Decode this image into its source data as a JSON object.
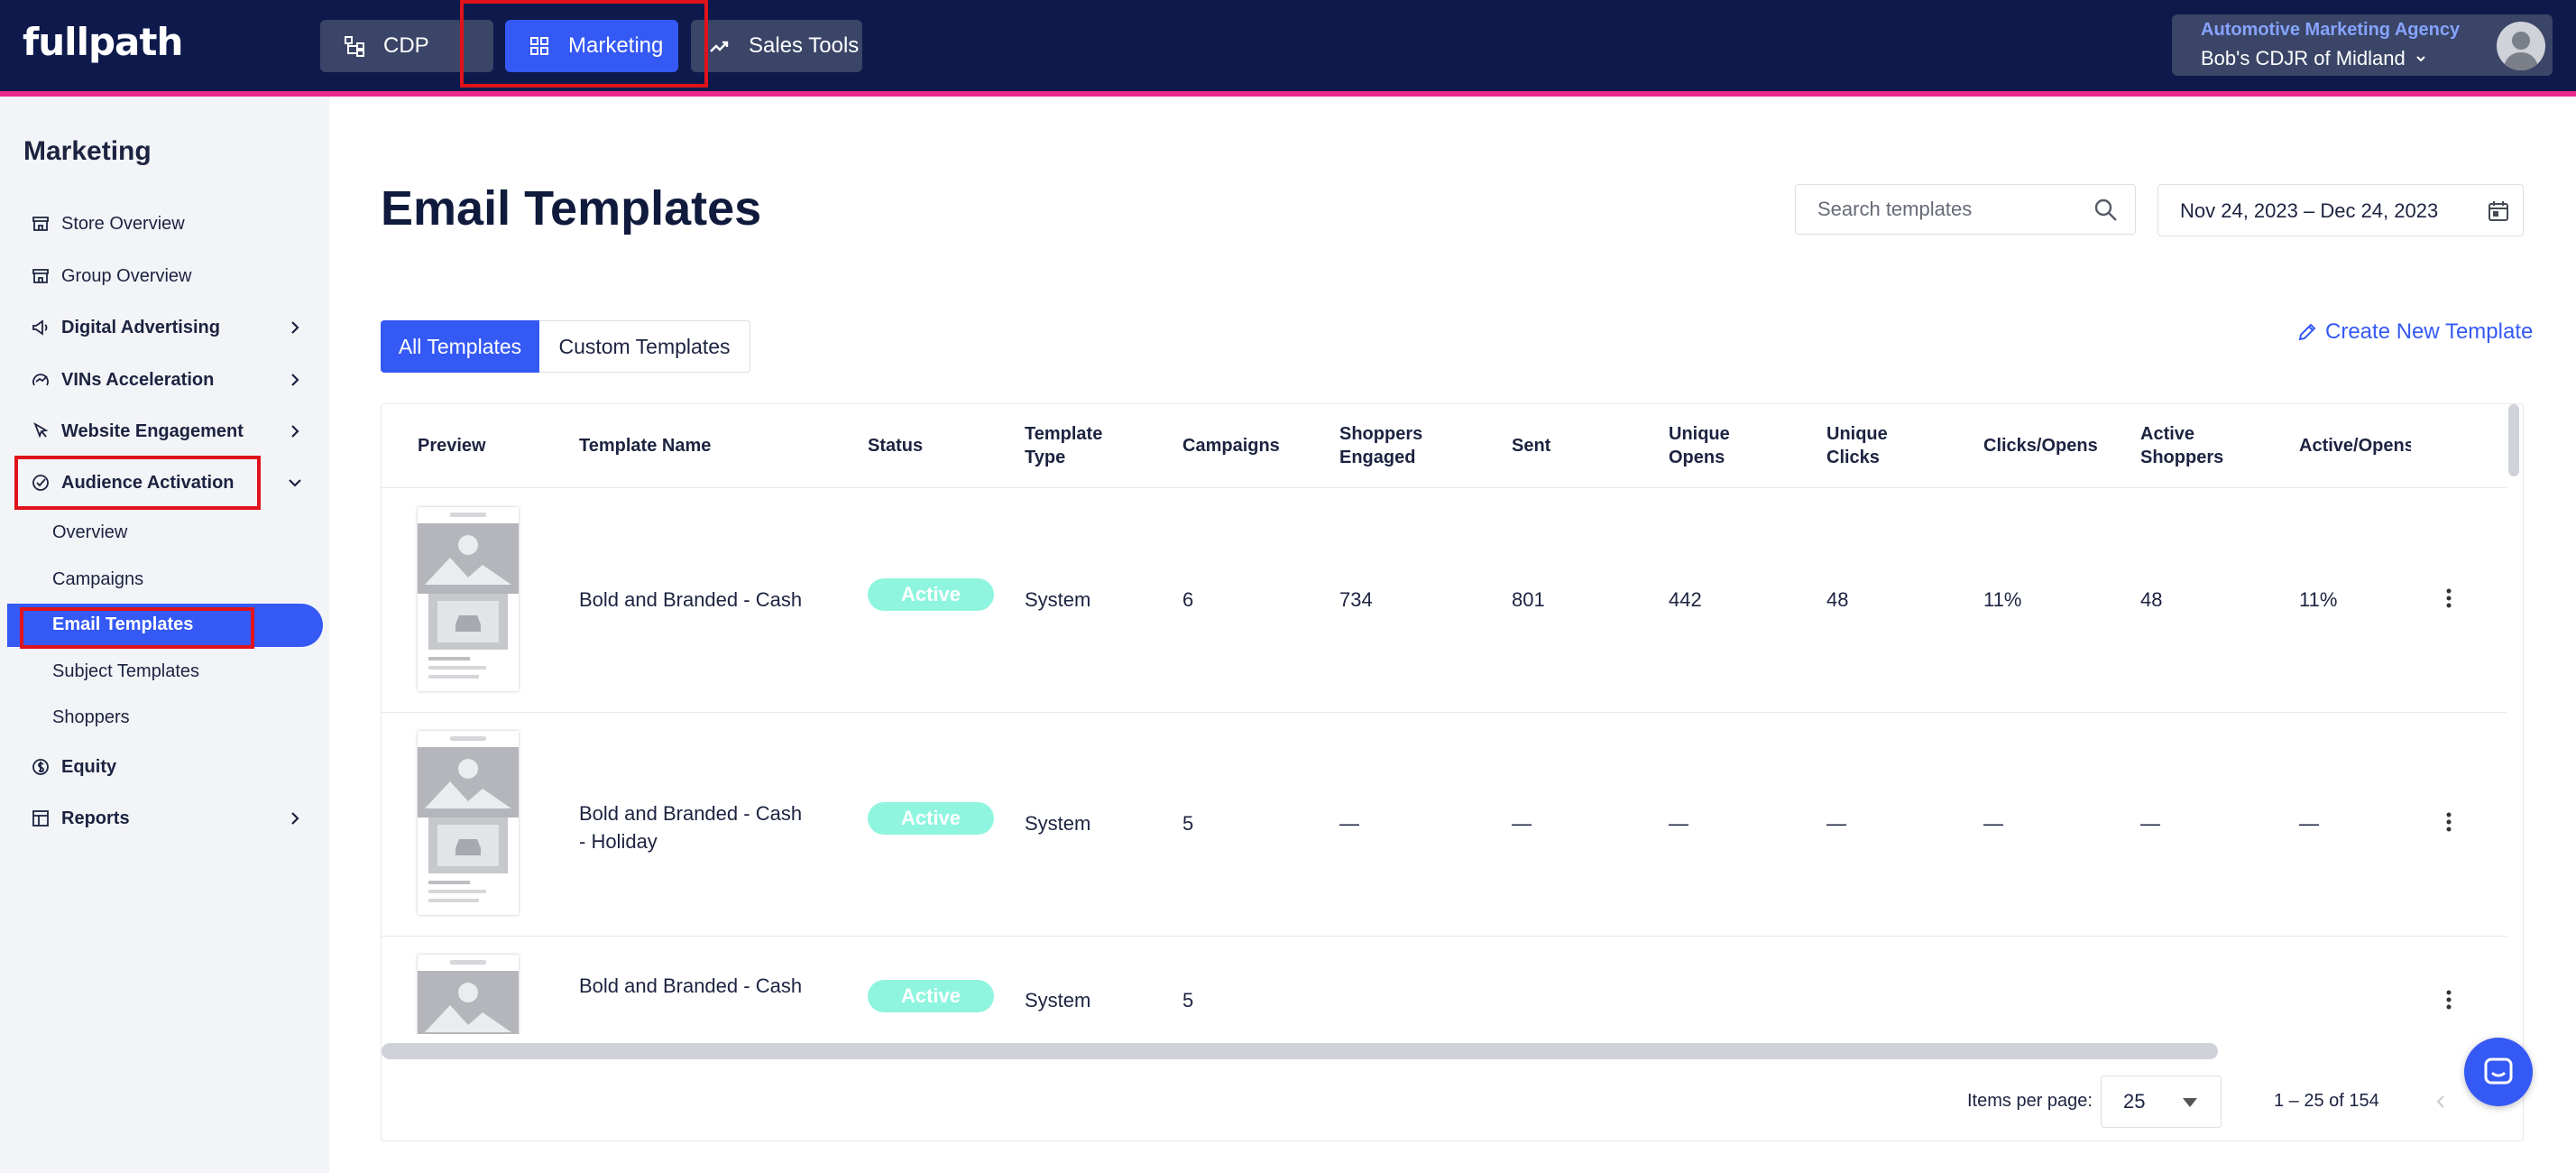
{
  "brand": {
    "logo": "fullpath"
  },
  "topnav": {
    "items": [
      {
        "label": "CDP",
        "icon": "hierarchy-icon"
      },
      {
        "label": "Marketing",
        "icon": "grid-icon"
      },
      {
        "label": "Sales Tools",
        "icon": "trend-icon"
      }
    ],
    "active": "Marketing"
  },
  "account": {
    "agency": "Automotive Marketing Agency",
    "store": "Bob's CDJR of Midland"
  },
  "sidebar": {
    "title": "Marketing",
    "items": [
      {
        "label": "Store Overview",
        "icon": "store-icon"
      },
      {
        "label": "Group Overview",
        "icon": "store-icon"
      },
      {
        "label": "Digital Advertising",
        "icon": "megaphone-icon"
      },
      {
        "label": "VINs Acceleration",
        "icon": "speed-icon"
      },
      {
        "label": "Website Engagement",
        "icon": "cursor-icon"
      },
      {
        "label": "Audience Activation",
        "icon": "check-circle-icon"
      },
      {
        "label": "Equity",
        "icon": "dollar-icon"
      },
      {
        "label": "Reports",
        "icon": "table-icon"
      }
    ],
    "sub_items": [
      "Overview",
      "Campaigns",
      "Email Templates",
      "Subject Templates",
      "Shoppers"
    ],
    "active_sub": "Email Templates"
  },
  "page": {
    "title": "Email Templates"
  },
  "search": {
    "placeholder": "Search templates"
  },
  "daterange": {
    "value": "Nov 24, 2023 – Dec 24, 2023"
  },
  "filters": {
    "all": "All Templates",
    "custom": "Custom Templates"
  },
  "actions": {
    "create": "Create New Template"
  },
  "table": {
    "headers": [
      "Preview",
      "Template Name",
      "Status",
      "Template Type",
      "Campaigns",
      "Shoppers Engaged",
      "Sent",
      "Unique Opens",
      "Unique Clicks",
      "Clicks/Opens",
      "Active Shoppers",
      "Active/Opens"
    ],
    "headers_wrapped": [
      [
        "Preview"
      ],
      [
        "Template Name"
      ],
      [
        "Status"
      ],
      [
        "Template",
        "Type"
      ],
      [
        "Campaigns"
      ],
      [
        "Shoppers",
        "Engaged"
      ],
      [
        "Sent"
      ],
      [
        "Unique",
        "Opens"
      ],
      [
        "Unique",
        "Clicks"
      ],
      [
        "Clicks/Opens"
      ],
      [
        "Active",
        "Shoppers"
      ],
      [
        "Active/Opens"
      ]
    ],
    "rows": [
      {
        "name_lines": [
          "Bold and Branded - Cash"
        ],
        "status": "Active",
        "type": "System",
        "campaigns": "6",
        "engaged": "734",
        "sent": "801",
        "opens": "442",
        "clicks": "48",
        "clicks_opens": "11%",
        "active_shoppers": "48",
        "active_opens": "11%"
      },
      {
        "name_lines": [
          "Bold and Branded - Cash",
          "- Holiday"
        ],
        "status": "Active",
        "type": "System",
        "campaigns": "5",
        "engaged": "—",
        "sent": "—",
        "opens": "—",
        "clicks": "—",
        "clicks_opens": "—",
        "active_shoppers": "—",
        "active_opens": "—"
      },
      {
        "name_lines": [
          "Bold and Branded - Cash"
        ],
        "status": "Active",
        "type": "System",
        "campaigns": "5",
        "engaged": "",
        "sent": "",
        "opens": "",
        "clicks": "",
        "clicks_opens": "",
        "active_shoppers": "",
        "active_opens": ""
      }
    ]
  },
  "pagination": {
    "items_label": "Items per page:",
    "page_size": "25",
    "range": "1 – 25 of 154"
  },
  "colors": {
    "nav_bg": "#0d1a4b",
    "accent": "#3559f5",
    "pink_strip": "#ec2a8b",
    "active_badge": "#8ff5df"
  }
}
